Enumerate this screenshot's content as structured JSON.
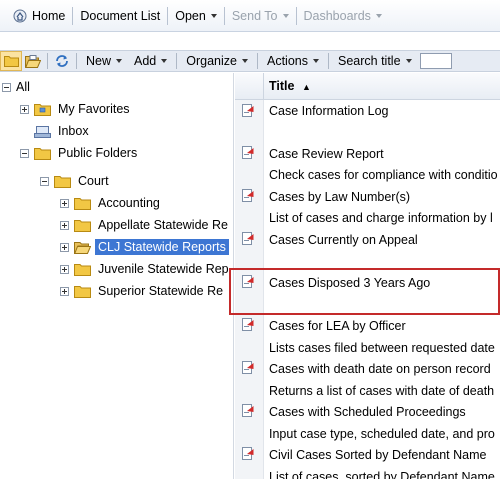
{
  "topbar": {
    "home": "Home",
    "document_list": "Document List",
    "open": "Open",
    "send_to": "Send To",
    "dashboards": "Dashboards"
  },
  "toolbar": {
    "new": "New",
    "add": "Add",
    "organize": "Organize",
    "actions": "Actions",
    "search_title": "Search title"
  },
  "tree": {
    "all": "All",
    "my_favorites": "My Favorites",
    "inbox": "Inbox",
    "public_folders": "Public Folders",
    "court": "Court",
    "accounting": "Accounting",
    "appellate": "Appellate Statewide Re",
    "clj": "CLJ Statewide Reports",
    "juvenile": "Juvenile Statewide Rep",
    "superior": "Superior Statewide Re"
  },
  "list": {
    "header_title": "Title",
    "items": [
      {
        "title": "Case Information Log",
        "description": ""
      },
      {
        "title": "Case Review Report",
        "description": "Check cases for compliance with conditio"
      },
      {
        "title": "Cases by Law Number(s)",
        "description": "List of cases and charge information by l"
      },
      {
        "title": "Cases Currently on Appeal",
        "description": ""
      },
      {
        "title": "Cases Disposed 3 Years Ago",
        "description": ""
      },
      {
        "title": "Cases for LEA by Officer",
        "description": "Lists cases filed between requested date"
      },
      {
        "title": "Cases with death date on person record",
        "description": "Returns a list of cases with date of death"
      },
      {
        "title": "Cases with Scheduled Proceedings",
        "description": "Input case type, scheduled date, and pro"
      },
      {
        "title": "Civil Cases Sorted by Defendant Name",
        "description": "List of cases, sorted by Defendant Name"
      }
    ]
  },
  "colors": {
    "selection": "#3d76d3",
    "highlight_border": "#c42a2a",
    "folder": "#f2c744"
  }
}
